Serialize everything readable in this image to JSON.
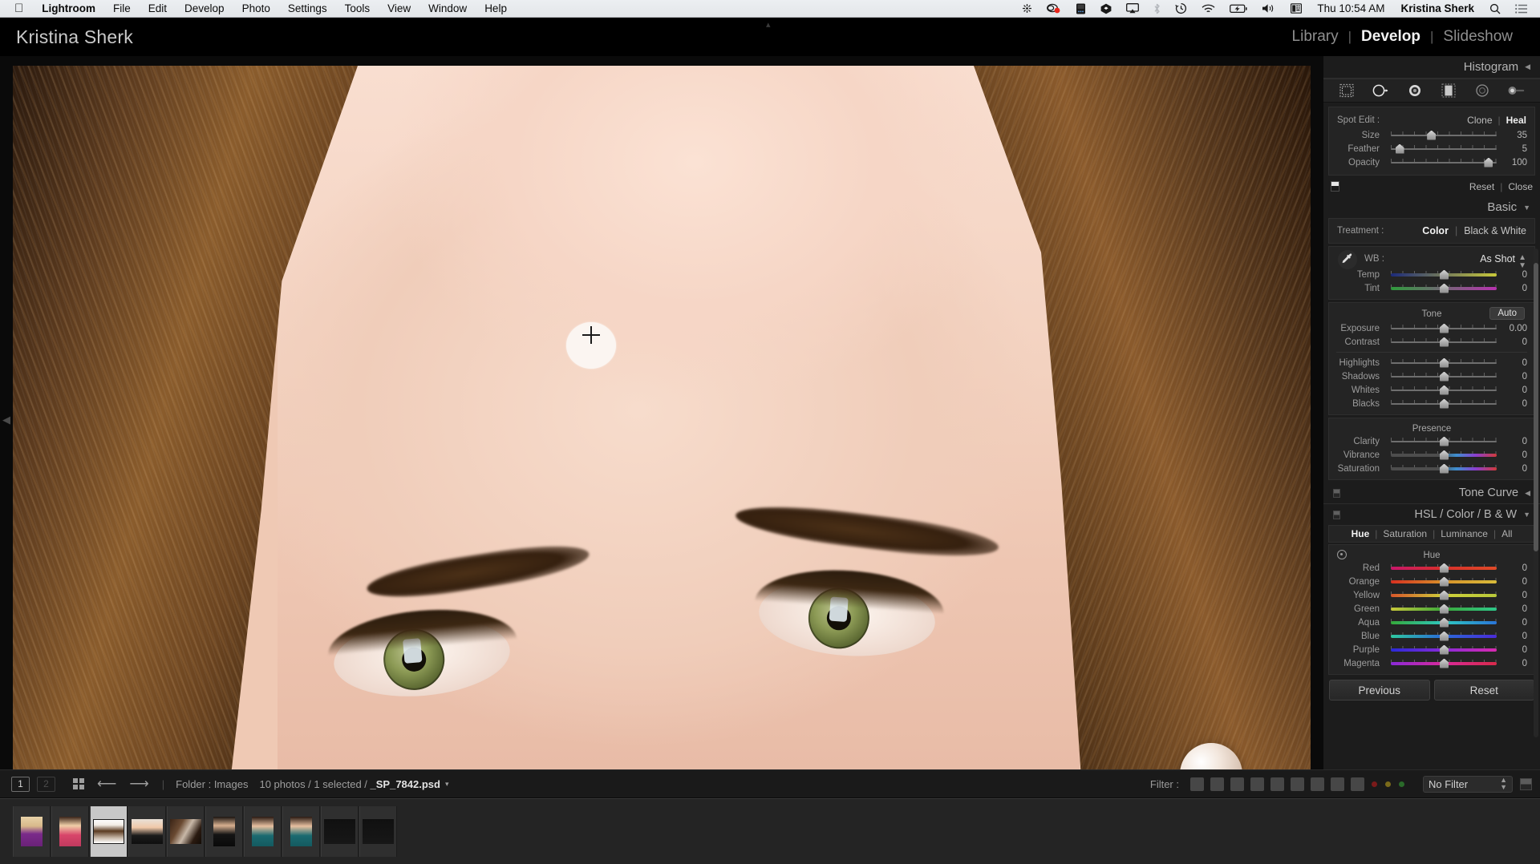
{
  "macos_menubar": {
    "apple_icon": "apple-logo",
    "items": [
      "Lightroom",
      "File",
      "Edit",
      "Develop",
      "Photo",
      "Settings",
      "Tools",
      "View",
      "Window",
      "Help"
    ],
    "active_app": "Lightroom",
    "status_icons": [
      "siri-icon",
      "screen-record-icon",
      "display-icon",
      "dropbox-icon",
      "airplay-icon",
      "bluetooth-icon",
      "timemachine-icon",
      "wifi-icon",
      "battery-icon",
      "volume-icon",
      "keyboard-input-icon"
    ],
    "clock": "Thu 10:54 AM",
    "user": "Kristina Sherk",
    "search_icon": "search-icon",
    "control_center_icon": "menu-list-icon"
  },
  "topbar": {
    "identity": "Kristina Sherk",
    "modules": [
      "Library",
      "Develop",
      "Slideshow"
    ],
    "active_module": "Develop",
    "separator": "|"
  },
  "right_panel": {
    "histogram": {
      "label": "Histogram",
      "collapse_glyph": "◀"
    },
    "tools": [
      "crop-overlay-icon",
      "spot-removal-icon",
      "red-eye-icon",
      "graduated-filter-icon",
      "radial-filter-icon",
      "adjustment-brush-icon"
    ],
    "spot_edit": {
      "label": "Spot Edit :",
      "modes": [
        "Clone",
        "Heal"
      ],
      "active_mode": "Heal",
      "separator": "|",
      "sliders": [
        {
          "label": "Size",
          "value": "35",
          "pos": 38
        },
        {
          "label": "Feather",
          "value": "5",
          "pos": 8
        },
        {
          "label": "Opacity",
          "value": "100",
          "pos": 92
        }
      ],
      "footer": {
        "swatch": "before-after-swatch",
        "reset": "Reset",
        "close": "Close",
        "separator": "|"
      }
    },
    "basic": {
      "label": "Basic",
      "collapse_glyph": "▼",
      "treatment": {
        "label": "Treatment :",
        "options": [
          "Color",
          "Black & White"
        ],
        "active": "Color",
        "separator": "|"
      },
      "wb": {
        "label": "WB :",
        "value": "As Shot",
        "eyedropper": "eyedropper-icon"
      },
      "wb_sliders": [
        {
          "label": "Temp",
          "value": "0",
          "pos": 50,
          "gradient": "linear-gradient(to right,#1c2a7a,#c9c93a)"
        },
        {
          "label": "Tint",
          "value": "0",
          "pos": 50,
          "gradient": "linear-gradient(to right,#2f9b3c,#b832b0)"
        }
      ],
      "tone": {
        "label": "Tone",
        "auto": "Auto"
      },
      "tone_sliders": [
        {
          "label": "Exposure",
          "value": "0.00",
          "pos": 50
        },
        {
          "label": "Contrast",
          "value": "0",
          "pos": 50
        }
      ],
      "tone_sliders2": [
        {
          "label": "Highlights",
          "value": "0",
          "pos": 50
        },
        {
          "label": "Shadows",
          "value": "0",
          "pos": 50
        },
        {
          "label": "Whites",
          "value": "0",
          "pos": 50
        },
        {
          "label": "Blacks",
          "value": "0",
          "pos": 50
        }
      ],
      "presence": {
        "label": "Presence"
      },
      "presence_sliders": [
        {
          "label": "Clarity",
          "value": "0",
          "pos": 50,
          "gradient": ""
        },
        {
          "label": "Vibrance",
          "value": "0",
          "pos": 50,
          "gradient": "linear-gradient(to right,#4d4d4d 45%,#3d8fd0 62%,#8a3fd0 80%,#d03a3a 100%)"
        },
        {
          "label": "Saturation",
          "value": "0",
          "pos": 50,
          "gradient": "linear-gradient(to right,#4d4d4d 45%,#3d8fd0 62%,#8a3fd0 80%,#d03a3a 100%)"
        }
      ]
    },
    "tone_curve": {
      "label": "Tone Curve",
      "collapse_glyph": "◀"
    },
    "hsl": {
      "label": "HSL / Color / B & W",
      "collapse_glyph": "▼",
      "tabs": [
        "Hue",
        "Saturation",
        "Luminance",
        "All"
      ],
      "active_tab": "Hue",
      "separator": "|",
      "subtitle": "Hue",
      "target_icon": "target-adjust-icon",
      "sliders": [
        {
          "label": "Red",
          "value": "0",
          "pos": 50,
          "gradient": "linear-gradient(to right,#c8166a,#d8302a,#e04a28)"
        },
        {
          "label": "Orange",
          "value": "0",
          "pos": 50,
          "gradient": "linear-gradient(to right,#d83020,#d8922a,#d8bb3a)"
        },
        {
          "label": "Yellow",
          "value": "0",
          "pos": 50,
          "gradient": "linear-gradient(to right,#d8562a,#cfcf3a,#b8c83a)"
        },
        {
          "label": "Green",
          "value": "0",
          "pos": 50,
          "gradient": "linear-gradient(to right,#c8c83a,#3aa83a,#2ec88a)"
        },
        {
          "label": "Aqua",
          "value": "0",
          "pos": 50,
          "gradient": "linear-gradient(to right,#35a83a,#2ec8c0,#2a74d8)"
        },
        {
          "label": "Blue",
          "value": "0",
          "pos": 50,
          "gradient": "linear-gradient(to right,#2ec8a0,#2a6ad8,#4a2ad8)"
        },
        {
          "label": "Purple",
          "value": "0",
          "pos": 50,
          "gradient": "linear-gradient(to right,#2a2ad8,#8a2ad8,#d82ab0)"
        },
        {
          "label": "Magenta",
          "value": "0",
          "pos": 50,
          "gradient": "linear-gradient(to right,#8a2ad8,#d82a9a,#d82a4a)"
        }
      ]
    },
    "buttons": {
      "previous": "Previous",
      "reset": "Reset"
    }
  },
  "bottom_toolbar": {
    "flag1": "1",
    "flag2": "2",
    "grid_icon": "grid-view-icon",
    "prev_icon": "arrow-left-icon",
    "next_icon": "arrow-right-icon",
    "folder_label": "Folder : Images",
    "photo_count": "10 photos / 1 selected / ",
    "filename": "_SP_7842.psd",
    "caret": "▾",
    "filter_label": "Filter :",
    "filter_value": "No Filter",
    "color_dots": [
      "#7a1a1a",
      "#7a6a1a",
      "#2a6a2a"
    ]
  },
  "filmstrip": {
    "selected_index": 2,
    "thumbs": [
      {
        "name": "blonde-woman-purple",
        "orient": "portrait",
        "colors": "#e8d2a8,#7a2a8a,#f0d8b8"
      },
      {
        "name": "woman-pink-top",
        "orient": "portrait",
        "colors": "#f0cfa8,#d8456a,#2a1a10"
      },
      {
        "name": "woman-white-bg",
        "orient": "landscape",
        "colors": "#ffffff,#5a3a20,#c8b8a8"
      },
      {
        "name": "woman-black-dress",
        "orient": "landscape",
        "colors": "#f0c8a8,#1a1a1a,#3a2a20"
      },
      {
        "name": "couple-event",
        "orient": "landscape",
        "colors": "#4a3020,#c8b8a8,#1a1008"
      },
      {
        "name": "man-dark-shirt",
        "orient": "portrait",
        "colors": "#d8b090,#121212,#0a0a0a"
      },
      {
        "name": "woman-teal-top-a",
        "orient": "portrait",
        "colors": "#e8c0a0,#1a6a70,#2a1a10"
      },
      {
        "name": "woman-teal-top-b",
        "orient": "portrait",
        "colors": "#e8c0a0,#1a6a70,#2a1a10"
      },
      {
        "name": "dark-frame-a",
        "orient": "landscape",
        "colors": "#0e0e0e,#141414,#0a0a0a"
      },
      {
        "name": "dark-frame-b",
        "orient": "landscape",
        "colors": "#0e0e0e,#141414,#0a0a0a"
      }
    ]
  },
  "photo": {
    "subject": "close-up-portrait-eyes-forehead",
    "healing_spot": "heal-brush-applied-patch",
    "cursor": "crosshair-brush-cursor"
  },
  "collapse_arrows": {
    "left": "◀",
    "right": "▶",
    "top": "▴",
    "bottom": "▾"
  }
}
